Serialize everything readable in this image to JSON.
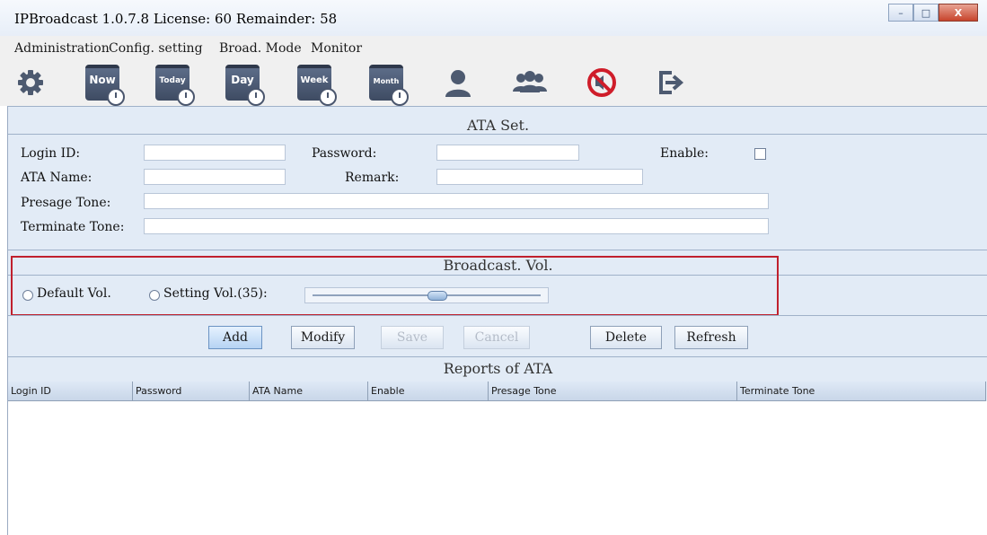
{
  "window": {
    "title": "IPBroadcast 1.0.7.8 License: 60 Remainder: 58",
    "controls": {
      "minimize": "–",
      "maximize": "□",
      "close": "X"
    }
  },
  "menu": [
    "Administration",
    "Config. setting",
    "Broad. Mode",
    "Monitor"
  ],
  "toolbar": {
    "buttons": [
      {
        "name": "settings",
        "icon": "gear-icon"
      },
      {
        "name": "now",
        "icon": "calendar-clock-icon",
        "label": "Now"
      },
      {
        "name": "today",
        "icon": "calendar-clock-icon",
        "label": "Today"
      },
      {
        "name": "day",
        "icon": "calendar-clock-icon",
        "label": "Day"
      },
      {
        "name": "week",
        "icon": "calendar-clock-icon",
        "label": "Week"
      },
      {
        "name": "month",
        "icon": "calendar-clock-icon",
        "label": "Month"
      },
      {
        "name": "user",
        "icon": "user-icon"
      },
      {
        "name": "users",
        "icon": "users-group-icon"
      },
      {
        "name": "mute",
        "icon": "no-sound-icon"
      },
      {
        "name": "exit",
        "icon": "exit-icon"
      }
    ]
  },
  "ata_set": {
    "title": "ATA Set.",
    "login_id_label": "Login ID:",
    "login_id_value": "",
    "password_label": "Password:",
    "password_value": "",
    "enable_label": "Enable:",
    "enable_checked": false,
    "ata_name_label": "ATA Name:",
    "ata_name_value": "",
    "remark_label": "Remark:",
    "remark_value": "",
    "presage_label": "Presage Tone:",
    "presage_value": "",
    "terminate_label": "Terminate Tone:",
    "terminate_value": ""
  },
  "broadcast_vol": {
    "title": "Broadcast. Vol.",
    "default_label": "Default Vol.",
    "setting_label": "Setting Vol.(35):",
    "volume": 35,
    "volume_fraction": 0.55,
    "highlight_color": "#c0202d"
  },
  "actions": {
    "add": "Add",
    "modify": "Modify",
    "save": "Save",
    "cancel": "Cancel",
    "delete": "Delete",
    "refresh": "Refresh"
  },
  "reports": {
    "title": "Reports of ATA",
    "columns": [
      "Login ID",
      "Password",
      "ATA Name",
      "Enable",
      "Presage Tone",
      "Terminate Tone"
    ],
    "rows": []
  }
}
